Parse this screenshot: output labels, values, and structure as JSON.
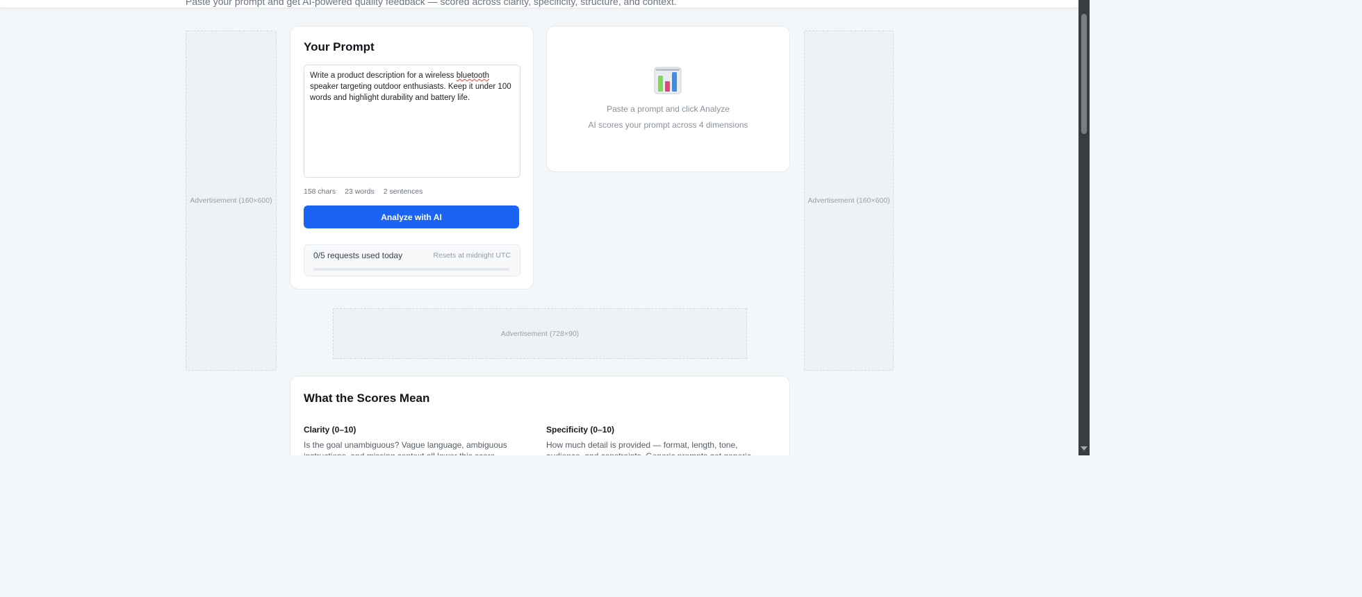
{
  "header": {
    "subtitle": "Paste your prompt and get AI-powered quality feedback — scored across clarity, specificity, structure, and context."
  },
  "ads": {
    "left": "Advertisement (160×600)",
    "right": "Advertisement (160×600)",
    "banner": "Advertisement (728×90)"
  },
  "prompt_card": {
    "title": "Your Prompt",
    "text_before": "Write a product description for a wireless ",
    "text_misspelled": "bluetooth",
    "text_after": " speaker targeting outdoor enthusiasts. Keep it under 100 words and highlight durability and battery life.",
    "chars": "158 chars",
    "words": "23 words",
    "sentences": "2 sentences",
    "analyze_label": "Analyze with AI"
  },
  "usage": {
    "text": "0/5 requests used today",
    "reset": "Resets at midnight UTC",
    "used": 0,
    "limit": 5
  },
  "result_card": {
    "icon": "bar-chart-icon",
    "line1": "Paste a prompt and click Analyze",
    "line2": "AI scores your prompt across 4 dimensions"
  },
  "scores": {
    "title": "What the Scores Mean",
    "items": [
      {
        "name": "Clarity (0–10)",
        "desc": "Is the goal unambiguous? Vague language, ambiguous instructions, and missing context all lower this score."
      },
      {
        "name": "Specificity (0–10)",
        "desc": "How much detail is provided — format, length, tone, audience, and constraints. Generic prompts get generic results."
      }
    ]
  },
  "colors": {
    "accent": "#1b63f2",
    "background": "#f3f7fa",
    "card": "#ffffff"
  }
}
